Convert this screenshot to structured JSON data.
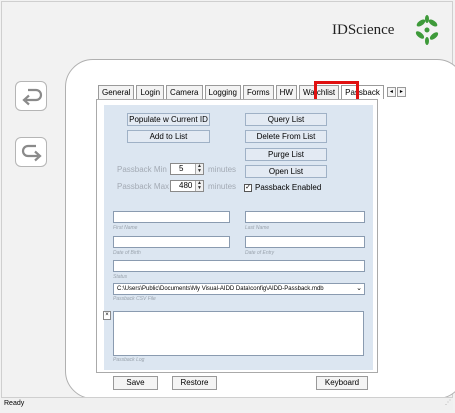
{
  "header": {
    "brand": "IDScience",
    "logo": "idscience-leaf-logo"
  },
  "nav": {
    "back_icon": "undo-arrow-icon",
    "forward_icon": "redo-arrow-icon"
  },
  "tabs": [
    {
      "label": "General"
    },
    {
      "label": "Login"
    },
    {
      "label": "Camera"
    },
    {
      "label": "Logging"
    },
    {
      "label": "Forms"
    },
    {
      "label": "HW"
    },
    {
      "label": "Watchlist"
    },
    {
      "label": "Passback",
      "active": true
    }
  ],
  "passback": {
    "populate_btn": "Populate w Current ID",
    "add_btn": "Add to List",
    "query_btn": "Query List",
    "delete_btn": "Delete From List",
    "purge_btn": "Purge  List",
    "open_btn": "Open  List",
    "min_label": "Passback Min",
    "min_value": "5",
    "max_label": "Passback Max",
    "max_value": "480",
    "minutes_unit": "minutes",
    "enabled_label": "Passback Enabled",
    "enabled": true,
    "first_name_caption": "First Name",
    "last_name_caption": "Last Name",
    "dob_caption": "Date of Birth",
    "doi_caption": "Date of Entry",
    "status_caption": "Status",
    "csv_path": "C:\\Users\\Public\\Documents\\My Visual-AIDD Data\\config\\AIDD-Passback.mdb",
    "csv_caption": "Passback CSV File",
    "log_caption": "Passback Log"
  },
  "footer": {
    "save": "Save",
    "restore": "Restore",
    "keyboard": "Keyboard"
  },
  "status": {
    "text": "Ready"
  },
  "colors": {
    "highlight": "#e01010",
    "form_bg": "#dce6f1",
    "button_bg": "#e3eaf3"
  }
}
